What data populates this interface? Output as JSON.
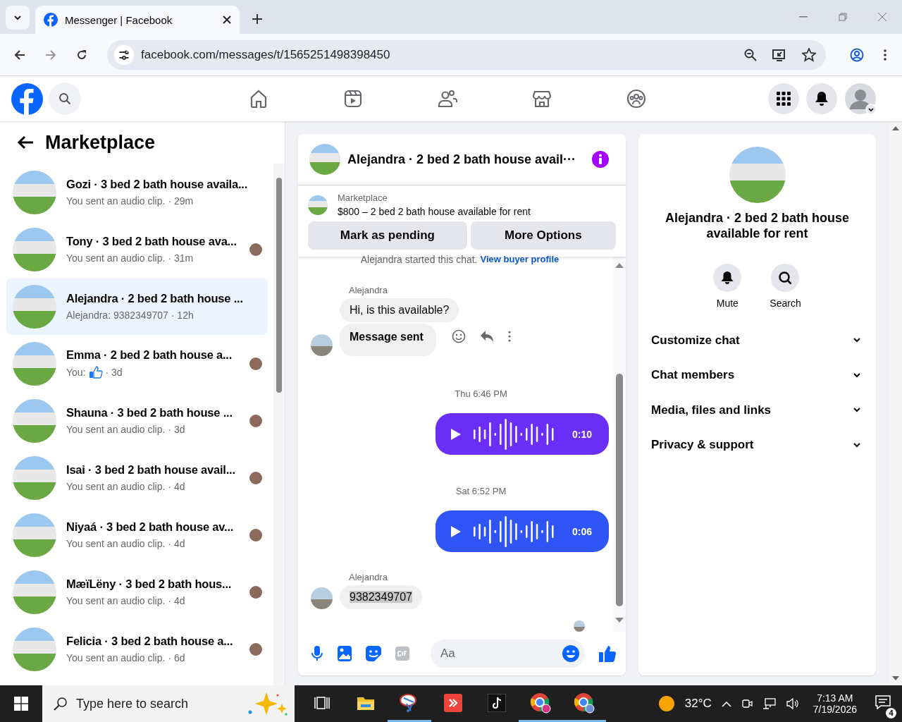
{
  "browser": {
    "tab_title": "Messenger | Facebook",
    "url": "facebook.com/messages/t/1565251498398450"
  },
  "sidebar": {
    "title": "Marketplace",
    "conversations": [
      {
        "name": "Gozi · 3 bed 2 bath house availa...",
        "preview": "You sent an audio clip.",
        "time": "· 29m",
        "like": false,
        "selected": false,
        "seen": false
      },
      {
        "name": "Tony · 3 bed 2 bath house ava...",
        "preview": "You sent an audio clip.",
        "time": "· 31m",
        "like": false,
        "selected": false,
        "seen": true
      },
      {
        "name": "Alejandra · 2 bed 2 bath house ...",
        "preview": "Alejandra: 9382349707",
        "time": "· 12h",
        "like": false,
        "selected": true,
        "seen": false
      },
      {
        "name": "Emma · 2 bed 2 bath house a...",
        "preview": "You:",
        "time": "· 3d",
        "like": true,
        "selected": false,
        "seen": true
      },
      {
        "name": "Shauna · 3 bed 2 bath house ...",
        "preview": "You sent an audio clip.",
        "time": "· 3d",
        "like": false,
        "selected": false,
        "seen": true
      },
      {
        "name": "Isai · 3 bed 2 bath house avail...",
        "preview": "You sent an audio clip.",
        "time": "· 4d",
        "like": false,
        "selected": false,
        "seen": true
      },
      {
        "name": "Niyaá · 3 bed 2 bath house av...",
        "preview": "You sent an audio clip.",
        "time": "· 4d",
        "like": false,
        "selected": false,
        "seen": true
      },
      {
        "name": "MæïLëny · 3 bed 2 bath hous...",
        "preview": "You sent an audio clip.",
        "time": "· 4d",
        "like": false,
        "selected": false,
        "seen": true
      },
      {
        "name": "Felicia · 3 bed 2 bath house a...",
        "preview": "You sent an audio clip.",
        "time": "· 6d",
        "like": false,
        "selected": false,
        "seen": true
      }
    ]
  },
  "chat": {
    "title": "Alejandra · 2 bed 2 bath house avail···",
    "listing": {
      "label": "Marketplace",
      "text": "$800 – 2 bed 2 bath house available for rent"
    },
    "buttons": [
      "Mark as pending",
      "More Options"
    ],
    "messages": [
      {
        "kind": "notice",
        "text": "Alejandra started this chat.",
        "link": "View buyer profile"
      },
      {
        "kind": "sender",
        "text": "Alejandra"
      },
      {
        "kind": "incoming",
        "text": "Hi, is this available?",
        "avatar": false,
        "highlighted": false,
        "actions": false
      },
      {
        "kind": "incoming",
        "text": "Message sent",
        "avatar": true,
        "highlighted": false,
        "actions": true
      },
      {
        "kind": "time",
        "text": "Thu 6:46 PM"
      },
      {
        "kind": "audio",
        "duration": "0:10",
        "color": "#6a2ef6"
      },
      {
        "kind": "time",
        "text": "Sat 6:52 PM"
      },
      {
        "kind": "audio",
        "duration": "0:06",
        "color": "#2f55f7"
      },
      {
        "kind": "sender",
        "text": "Alejandra"
      },
      {
        "kind": "incoming",
        "text": "9382349707",
        "avatar": true,
        "highlighted": true,
        "actions": false
      }
    ],
    "composer": {
      "placeholder": "Aa"
    }
  },
  "details": {
    "title": "Alejandra · 2 bed 2 bath house available for rent",
    "actions": [
      {
        "kind": "mute",
        "label": "Mute"
      },
      {
        "kind": "search",
        "label": "Search"
      }
    ],
    "sections": [
      "Customize chat",
      "Chat members",
      "Media, files and links",
      "Privacy & support"
    ]
  },
  "taskbar": {
    "search_placeholder": "Type here to search",
    "apps": [
      {
        "kind": "taskview",
        "running": false
      },
      {
        "kind": "files",
        "running": false
      },
      {
        "kind": "snip",
        "running": true
      },
      {
        "kind": "remote",
        "running": false
      },
      {
        "kind": "video",
        "running": false
      },
      {
        "kind": "browser",
        "running": true
      },
      {
        "kind": "browser2",
        "running": true
      }
    ],
    "weather": "32°C",
    "time": "7:13 AM",
    "date": "7/19/2026",
    "notifications": "4"
  }
}
